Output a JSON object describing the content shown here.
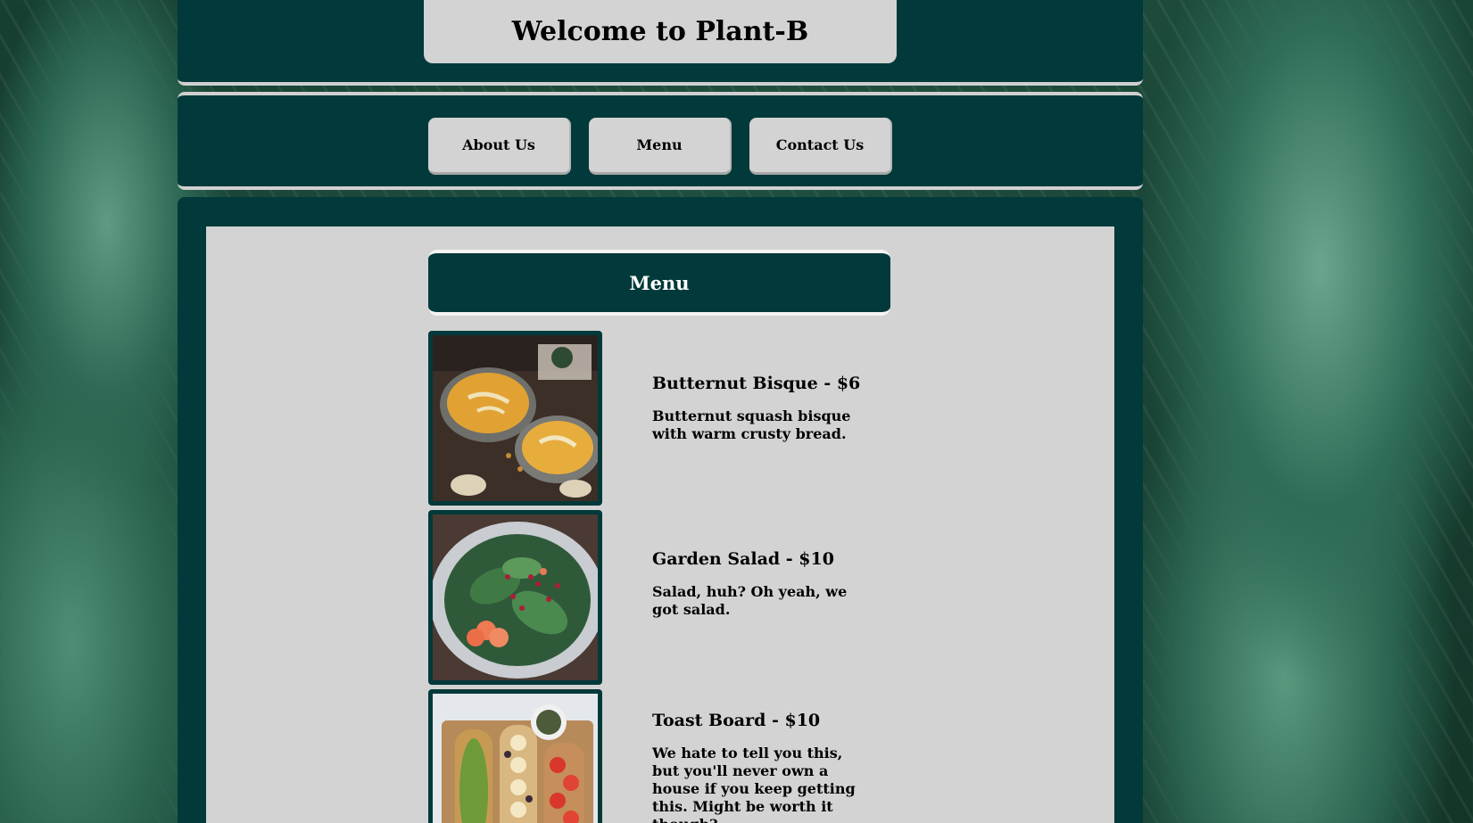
{
  "header": {
    "title": "Welcome to Plant-B"
  },
  "nav": {
    "items": [
      {
        "label": "About Us"
      },
      {
        "label": "Menu"
      },
      {
        "label": "Contact Us"
      }
    ]
  },
  "menu": {
    "heading": "Menu",
    "items": [
      {
        "name": "Butternut Bisque - $6",
        "description": "Butternut squash bisque with warm crusty bread.",
        "image": "soup-bowls-photo"
      },
      {
        "name": "Garden Salad - $10",
        "description": "Salad, huh? Oh yeah, we got salad.",
        "image": "salad-plate-photo"
      },
      {
        "name": "Toast Board - $10",
        "description": "We hate to tell you this, but you'll never own a house if you keep getting this. Might be worth it though?",
        "image": "toast-board-photo"
      }
    ]
  },
  "colors": {
    "frame": "#02393a",
    "panel": "#d3d3d3",
    "border": "#d0d0d0"
  }
}
